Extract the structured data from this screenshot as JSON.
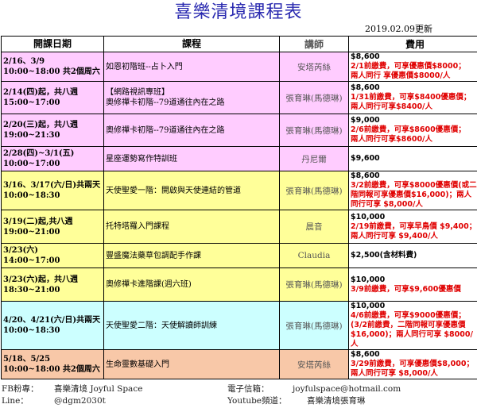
{
  "title": "喜樂清境課程表",
  "update_date": "2019.02.09更新",
  "headers": {
    "date": "開課日期",
    "course": "課程",
    "teacher": "講師",
    "fee": "費用"
  },
  "rows": [
    {
      "date1": "2/16、3/9",
      "date2": "10:00~18:00 共2個周六",
      "course1": "如恩初階班--占卜入門",
      "course2": "",
      "teacher": "安塔芮絲",
      "price": "$8,600",
      "note1": "2/1前繳費，可享優惠價$8000；",
      "note2": "兩人同行 享優惠價$8000/人",
      "note3": ""
    },
    {
      "date1": "2/14(四)起，共八週",
      "date2": "15:00~17:00",
      "course1": "【網路視訊專班】",
      "course2": "奧修禪卡初階--79道通往內在之路",
      "teacher": "張育琳(馬德琳)",
      "price": "$8,600",
      "note1": "1/31前繳費，可享$8400優惠價；",
      "note2": "兩人同行可享$8400/人",
      "note3": ""
    },
    {
      "date1": "2/20(三)起，共八週",
      "date2": "19:00~21:30",
      "course1": "奧修禪卡初階--79道通往內在之路",
      "course2": "",
      "teacher": "張育琳(馬德琳)",
      "price": "$9,000",
      "note1": "2/6前繳費，可享$8600優惠價；",
      "note2": "兩人同行可享$8600/人",
      "note3": ""
    },
    {
      "date1": "2/28(四)~3/1(五)",
      "date2": "10:00~17:00",
      "course1": "星座運勢寫作特訓班",
      "course2": "",
      "teacher": "丹尼爾",
      "price": "$9,600",
      "note1": "",
      "note2": "",
      "note3": ""
    },
    {
      "date1": "3/16、3/17(六/日)共兩天",
      "date2": "10:00~18:30",
      "course1": "天使聖愛一階：開啟與天使連結的管道",
      "course2": "",
      "teacher": "張育琳(馬德琳)",
      "price": "$8,600",
      "note1": "3/2前繳費，可享$8000優惠價(或二",
      "note2": "階同報可享優惠價$16,000)；兩人",
      "note3": "同行可享 $8,000/人"
    },
    {
      "date1": "3/19(二)起,共八週",
      "date2": "19:00~21:00",
      "course1": "托特塔羅入門課程",
      "course2": "",
      "teacher": "晨音",
      "price": "$10,000",
      "note1": "2/19前繳費，可享早鳥價 $9,400；",
      "note2": "兩人同行可享 $9,400/人",
      "note3": ""
    },
    {
      "date1": "3/23(六)",
      "date2": "14:00~17:00",
      "course1": "豐盛魔法藥草包調配手作課",
      "course2": "",
      "teacher": "Claudia",
      "price": "$2,500(含材料費)",
      "note1": "",
      "note2": "",
      "note3": ""
    },
    {
      "date1": "3/23(六)起，共八週",
      "date2": "18:30~21:00",
      "course1": "奧修禪卡進階課(週六班)",
      "course2": "",
      "teacher": "張育琳(馬德琳)",
      "price": "$10,000",
      "note1": "3/9前繳費，可享$9,600優惠價",
      "note2": "",
      "note3": ""
    },
    {
      "date1": "4/20、4/21(六/日)共兩天",
      "date2": "10:00~18:30",
      "course1": "天使聖愛二階：天使解讀師訓練",
      "course2": "",
      "teacher": "張育琳(馬德琳)",
      "price": "$10,000",
      "note1": "4/6前繳費，可享$9000優惠價；",
      "note2": "(3/2前繳費，二階同報可享優惠價",
      "note3": "$16,000)；兩人同行可享 $8000/人"
    },
    {
      "date1": "5/18、5/25",
      "date2": "10:00~18:00 共2個周六",
      "course1": "生命靈數基礎入門",
      "course2": "",
      "teacher": "安塔芮絲",
      "price": "$8,600",
      "note1": "3/29前繳費，可享優惠價$8,000；",
      "note2": "兩人同行可享 $8,000/人",
      "note3": ""
    }
  ],
  "row_styles": [
    "pink",
    "pink",
    "pink",
    "pink",
    "yellow",
    "yellow",
    "yellow",
    "yellow",
    "cyan",
    "peach"
  ],
  "colors": {
    "title": "#2a2ab0",
    "pink": "#ffccff",
    "yellow": "#ffff99",
    "cyan": "#ccffff",
    "peach": "#f8c8a8",
    "note": "#e00000"
  },
  "footer": {
    "fb_label": "FB粉專：",
    "fb_value": "喜樂清境 Joyful Space",
    "email_label": "電子信箱：",
    "email_value": "joyfulspace@hotmail.com",
    "line_label": "Line：",
    "line_value": "@dgm2030t",
    "youtube_label": "Youtube頻道：",
    "youtube_value": "喜樂清境張育琳"
  }
}
